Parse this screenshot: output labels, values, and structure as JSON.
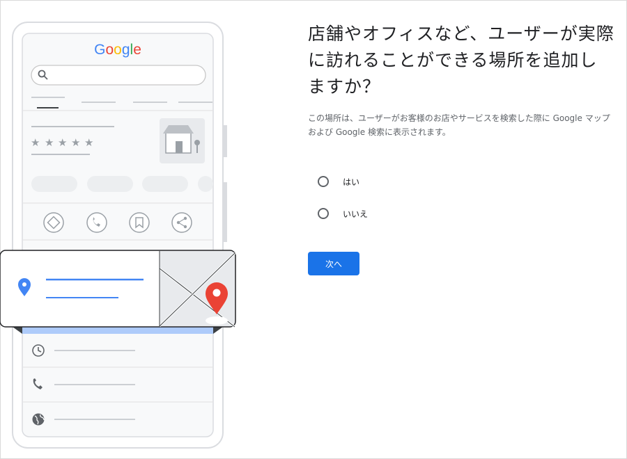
{
  "illustration": {
    "logo_text": "Google",
    "logo_colors": [
      "#4285F4",
      "#EA4335",
      "#FBBC05",
      "#4285F4",
      "#34A853",
      "#EA4335"
    ],
    "rating_stars": 5,
    "action_icons": [
      "directions-icon",
      "phone-icon",
      "bookmark-icon",
      "share-icon"
    ],
    "detail_icons": [
      "clock-icon",
      "phone-icon",
      "globe-icon"
    ]
  },
  "question": {
    "title": "店舗やオフィスなど、ユーザーが実際に訪れることができる場所を追加しますか？",
    "description": "この場所は、ユーザーがお客様のお店やサービスを検索した際に Google マップおよび Google 検索に表示されます。"
  },
  "options": [
    {
      "label": "はい",
      "selected": false
    },
    {
      "label": "いいえ",
      "selected": false
    }
  ],
  "next_button": {
    "label": "次へ"
  },
  "colors": {
    "accent": "#1a73e8",
    "pin_red": "#EA4335",
    "pin_blue": "#4285F4"
  }
}
